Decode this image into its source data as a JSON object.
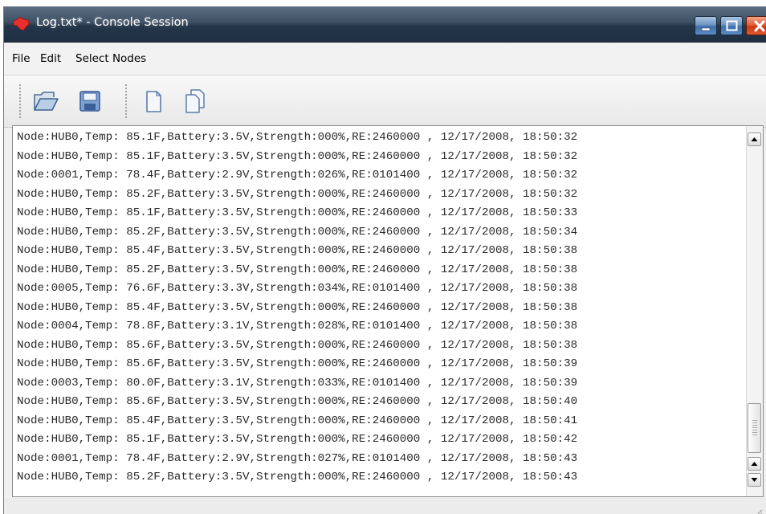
{
  "window": {
    "title": "Log.txt* - Console Session"
  },
  "menu": {
    "file": "File",
    "edit": "Edit",
    "select_nodes": "Select Nodes"
  },
  "toolbar": {
    "icons": [
      "open-folder-icon",
      "save-disk-icon",
      "new-document-icon",
      "copy-document-icon"
    ]
  },
  "log": {
    "lines": [
      "Node:HUB0,Temp: 85.1F,Battery:3.5V,Strength:000%,RE:2460000 , 12/17/2008, 18:50:32",
      "Node:HUB0,Temp: 85.1F,Battery:3.5V,Strength:000%,RE:2460000 , 12/17/2008, 18:50:32",
      "Node:0001,Temp: 78.4F,Battery:2.9V,Strength:026%,RE:0101400 , 12/17/2008, 18:50:32",
      "Node:HUB0,Temp: 85.2F,Battery:3.5V,Strength:000%,RE:2460000 , 12/17/2008, 18:50:32",
      "Node:HUB0,Temp: 85.1F,Battery:3.5V,Strength:000%,RE:2460000 , 12/17/2008, 18:50:33",
      "Node:HUB0,Temp: 85.2F,Battery:3.5V,Strength:000%,RE:2460000 , 12/17/2008, 18:50:34",
      "Node:HUB0,Temp: 85.4F,Battery:3.5V,Strength:000%,RE:2460000 , 12/17/2008, 18:50:38",
      "Node:HUB0,Temp: 85.2F,Battery:3.5V,Strength:000%,RE:2460000 , 12/17/2008, 18:50:38",
      "Node:0005,Temp: 76.6F,Battery:3.3V,Strength:034%,RE:0101400 , 12/17/2008, 18:50:38",
      "Node:HUB0,Temp: 85.4F,Battery:3.5V,Strength:000%,RE:2460000 , 12/17/2008, 18:50:38",
      "Node:0004,Temp: 78.8F,Battery:3.1V,Strength:028%,RE:0101400 , 12/17/2008, 18:50:38",
      "Node:HUB0,Temp: 85.6F,Battery:3.5V,Strength:000%,RE:2460000 , 12/17/2008, 18:50:38",
      "Node:HUB0,Temp: 85.6F,Battery:3.5V,Strength:000%,RE:2460000 , 12/17/2008, 18:50:39",
      "Node:0003,Temp: 80.0F,Battery:3.1V,Strength:033%,RE:0101400 , 12/17/2008, 18:50:39",
      "Node:HUB0,Temp: 85.6F,Battery:3.5V,Strength:000%,RE:2460000 , 12/17/2008, 18:50:40",
      "Node:HUB0,Temp: 85.4F,Battery:3.5V,Strength:000%,RE:2460000 , 12/17/2008, 18:50:41",
      "Node:HUB0,Temp: 85.1F,Battery:3.5V,Strength:000%,RE:2460000 , 12/17/2008, 18:50:42",
      "Node:0001,Temp: 78.4F,Battery:2.9V,Strength:027%,RE:0101400 , 12/17/2008, 18:50:43",
      "Node:HUB0,Temp: 85.2F,Battery:3.5V,Strength:000%,RE:2460000 , 12/17/2008, 18:50:43"
    ]
  },
  "colors": {
    "titlebar": "#2b3d52",
    "close_button": "#d8482a",
    "app_icon": "#e8312f"
  }
}
